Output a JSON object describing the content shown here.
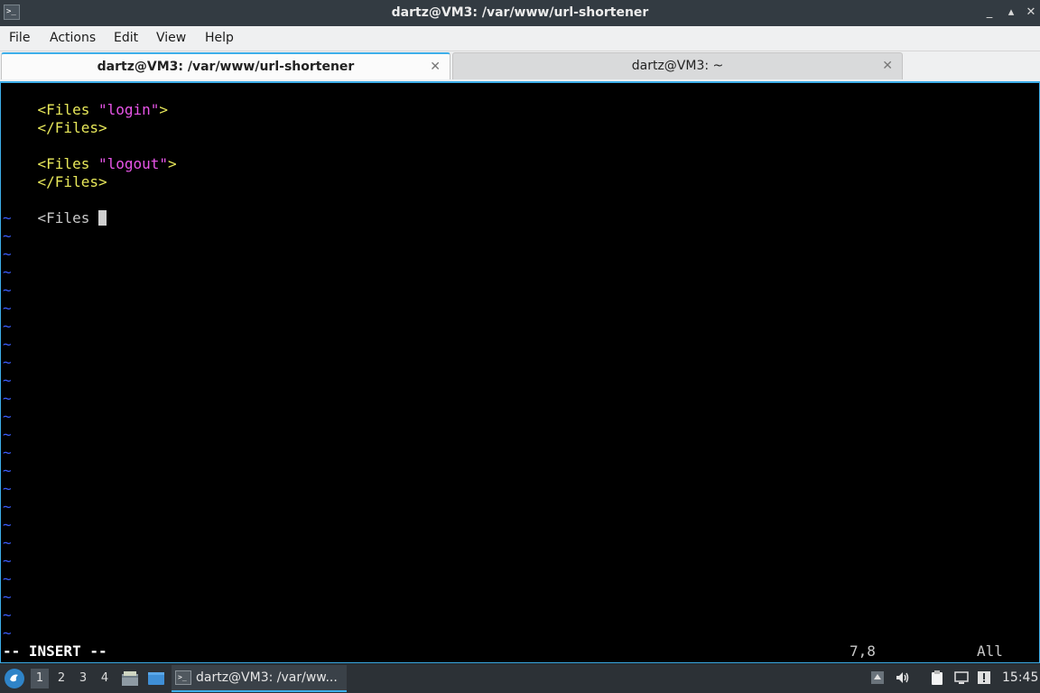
{
  "window": {
    "title": "dartz@VM3: /var/www/url-shortener",
    "app_icon_glyph": ">_",
    "minimize_glyph": "_",
    "maximize_glyph": "▴",
    "close_glyph": "✕"
  },
  "menu": [
    "File",
    "Actions",
    "Edit",
    "View",
    "Help"
  ],
  "tabs": [
    {
      "label": "dartz@VM3: /var/www/url-shortener",
      "active": true,
      "close": "✕"
    },
    {
      "label": "dartz@VM3: ~",
      "active": false,
      "close": "✕"
    }
  ],
  "editor": {
    "lines": [
      {
        "tag": "<Files",
        "arg": "\"login\"",
        "end": ">"
      },
      {
        "tag": "</Files>"
      },
      {
        "blank": true
      },
      {
        "tag": "<Files",
        "arg": "\"logout\"",
        "end": ">"
      },
      {
        "tag": "</Files>"
      },
      {
        "blank": true
      },
      {
        "typing": "<Files "
      }
    ],
    "tilde": "~",
    "tilde_rows": 24,
    "mode": "-- INSERT --",
    "position": "7,8",
    "scroll": "All"
  },
  "colors": {
    "tag": "#e8e85a",
    "string": "#e855e8",
    "tilde": "#3b5dfc",
    "accent": "#3daee9"
  },
  "taskbar": {
    "workspaces": [
      "1",
      "2",
      "3",
      "4"
    ],
    "active_workspace": "1",
    "task_label": "dartz@VM3: /var/ww...",
    "task_icon_glyph": ">_",
    "clock": "15:45",
    "icons": [
      "start-menu-icon",
      "file-manager-icon",
      "show-desktop-icon",
      "terminal-icon",
      "tray-arrow-icon",
      "volume-icon",
      "clipboard-icon",
      "network-icon",
      "update-notifier-icon"
    ]
  }
}
